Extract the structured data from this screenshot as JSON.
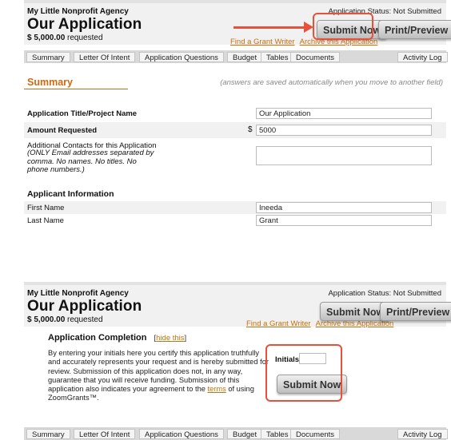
{
  "header": {
    "agency": "My Little Nonprofit Agency",
    "title": "Our Application",
    "amount": "$ 5,000.00",
    "amount_suffix": " requested",
    "status": "Application Status: Not Submitted",
    "find_link": "Find a Grant Writer",
    "archive_link": "Archive this Application",
    "submit_label": "Submit Now",
    "print_label": "Print/Preview"
  },
  "tabs": [
    "Summary",
    "Letter Of Intent",
    "Application Questions",
    "Budget",
    "Tables",
    "Documents"
  ],
  "activity_log": "Activity Log",
  "summary": {
    "title": "Summary",
    "note": "(answers are saved automatically when you move to another field)",
    "fields": {
      "title_label": "Application Title/Project Name",
      "title_value": "Our Application",
      "amount_label": "Amount Requested",
      "amount_symbol": "$",
      "amount_value": "5000",
      "contacts_label": "Additional Contacts for this Application",
      "contacts_hint": "(ONLY Email addresses separated by comma. No names. No titles. No phone numbers.)",
      "contacts_value": ""
    }
  },
  "applicant": {
    "title": "Applicant Information",
    "first_label": "First Name",
    "first_value": "Ineeda",
    "last_label": "Last Name",
    "last_value": "Grant"
  },
  "completion": {
    "title": "Application Completion",
    "hide_open": "[",
    "hide_link": "hide this",
    "hide_close": "]",
    "text_before": "By entering your initials here you certify this application truthfully and accurately represents your request and is hereby submitted for review. Submission of this application does not, in any way, guarantee that you will receive funding. Submission of this application also indicates your agreement to the ",
    "terms_link": "terms",
    "text_after": " of using ZoomGrants™.",
    "initials_label": "Initials",
    "initials_value": "",
    "submit_label": "Submit Now"
  },
  "colors": {
    "accent_orange": "#cf6a0f",
    "callout_red": "#e8503a",
    "link": "#c8700a"
  }
}
